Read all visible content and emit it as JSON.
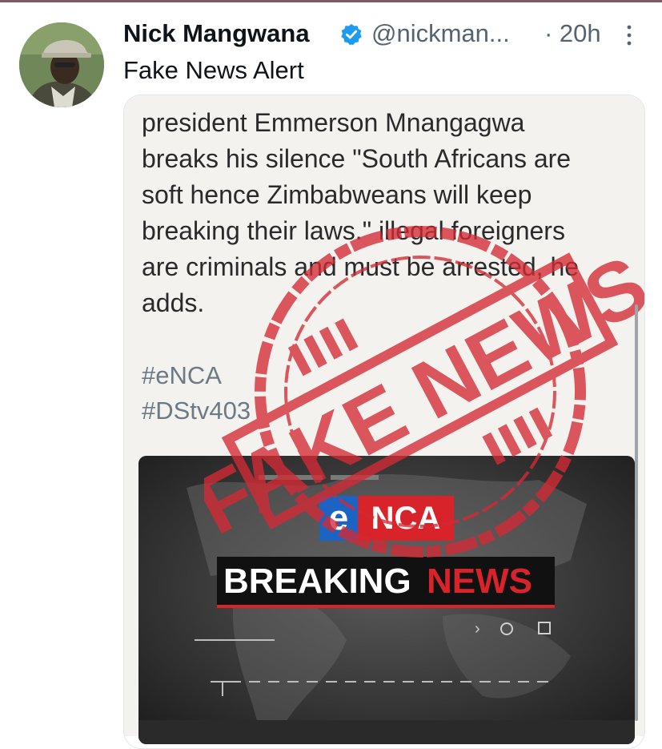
{
  "tweet": {
    "display_name": "Nick Mangwana",
    "handle": "@nickman...",
    "timestamp": "· 20h",
    "text": "Fake News Alert"
  },
  "media": {
    "post_lines": [
      "president Emmerson Mnangagwa",
      "breaks his silence \"South Africans are",
      "soft hence Zimbabweans will keep",
      "breaking their laws.\" illegal foreigners",
      "are criminals and must be arrested, he",
      "adds."
    ],
    "hashtags": [
      "#eNCA",
      "#DStv403"
    ],
    "stamp_text": "FAKE NEWS",
    "logo_e": "e",
    "logo_nca": "NCA",
    "breaking_word": "BREAKING",
    "news_word": "NEWS"
  },
  "colors": {
    "stamp_red": "#d42a34",
    "verified_blue": "#1d9bf0",
    "news_red": "#d8232a"
  }
}
